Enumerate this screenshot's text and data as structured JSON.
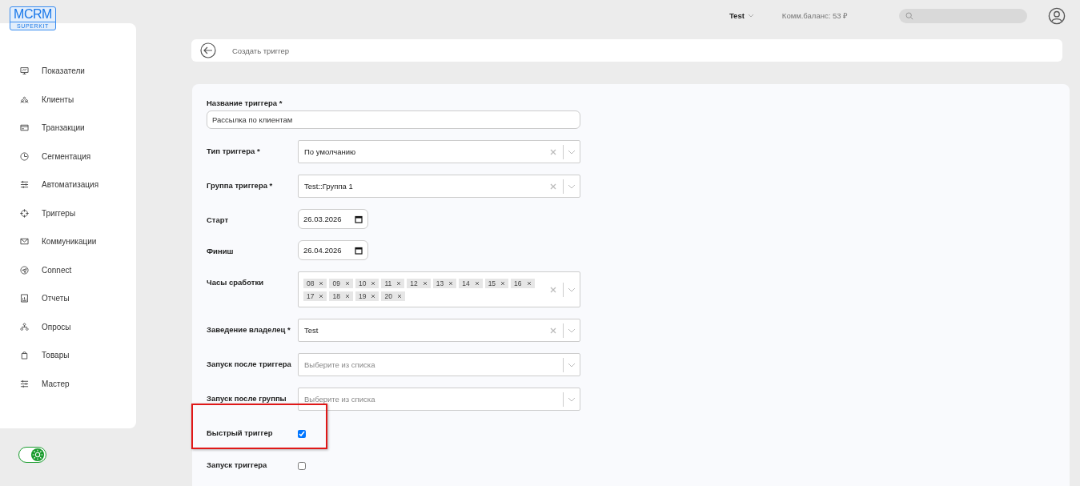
{
  "logo": {
    "title": "MCRM",
    "subtitle": "SUPERKIT"
  },
  "sidebar": {
    "items": [
      {
        "label": "Показатели"
      },
      {
        "label": "Клиенты"
      },
      {
        "label": "Транзакции"
      },
      {
        "label": "Сегментация"
      },
      {
        "label": "Автоматизация"
      },
      {
        "label": "Триггеры"
      },
      {
        "label": "Коммуникации"
      },
      {
        "label": "Connect"
      },
      {
        "label": "Отчеты"
      },
      {
        "label": "Опросы"
      },
      {
        "label": "Товары"
      },
      {
        "label": "Мастер"
      }
    ]
  },
  "theme_toggle": {
    "on": true
  },
  "topbar": {
    "account": "Test",
    "balance": "Комм.баланс: 53 ₽"
  },
  "breadcrumb": {
    "title": "Создать триггер"
  },
  "form": {
    "fields": [
      {
        "kind": "text",
        "label": "Название триггера *",
        "value": "Рассылка по клиентам"
      },
      {
        "kind": "select",
        "label": "Тип триггера *",
        "value": "По умолчанию",
        "clearable": true
      },
      {
        "kind": "select",
        "label": "Группа триггера *",
        "value": "Test::Группа 1",
        "clearable": true
      },
      {
        "kind": "date",
        "label": "Старт",
        "value": "26.03.2026"
      },
      {
        "kind": "date",
        "label": "Финиш",
        "value": "26.04.2026"
      },
      {
        "kind": "multiselect",
        "label": "Часы сработки",
        "tags": [
          "08",
          "09",
          "10",
          "11",
          "12",
          "13",
          "14",
          "15",
          "16",
          "17",
          "18",
          "19",
          "20"
        ],
        "clearable": true
      },
      {
        "kind": "select",
        "label": "Заведение владелец *",
        "value": "Test",
        "clearable": true
      },
      {
        "kind": "select",
        "label": "Запуск после триггера",
        "placeholder": "Выберите из списка",
        "clearable": false
      },
      {
        "kind": "select",
        "label": "Запуск после группы",
        "placeholder": "Выберите из списка",
        "clearable": false
      },
      {
        "kind": "checkbox",
        "label": "Быстрый триггер",
        "checked": true,
        "highlighted": true
      },
      {
        "kind": "checkbox",
        "label": "Запуск триггера",
        "checked": false,
        "highlighted": false
      }
    ]
  }
}
